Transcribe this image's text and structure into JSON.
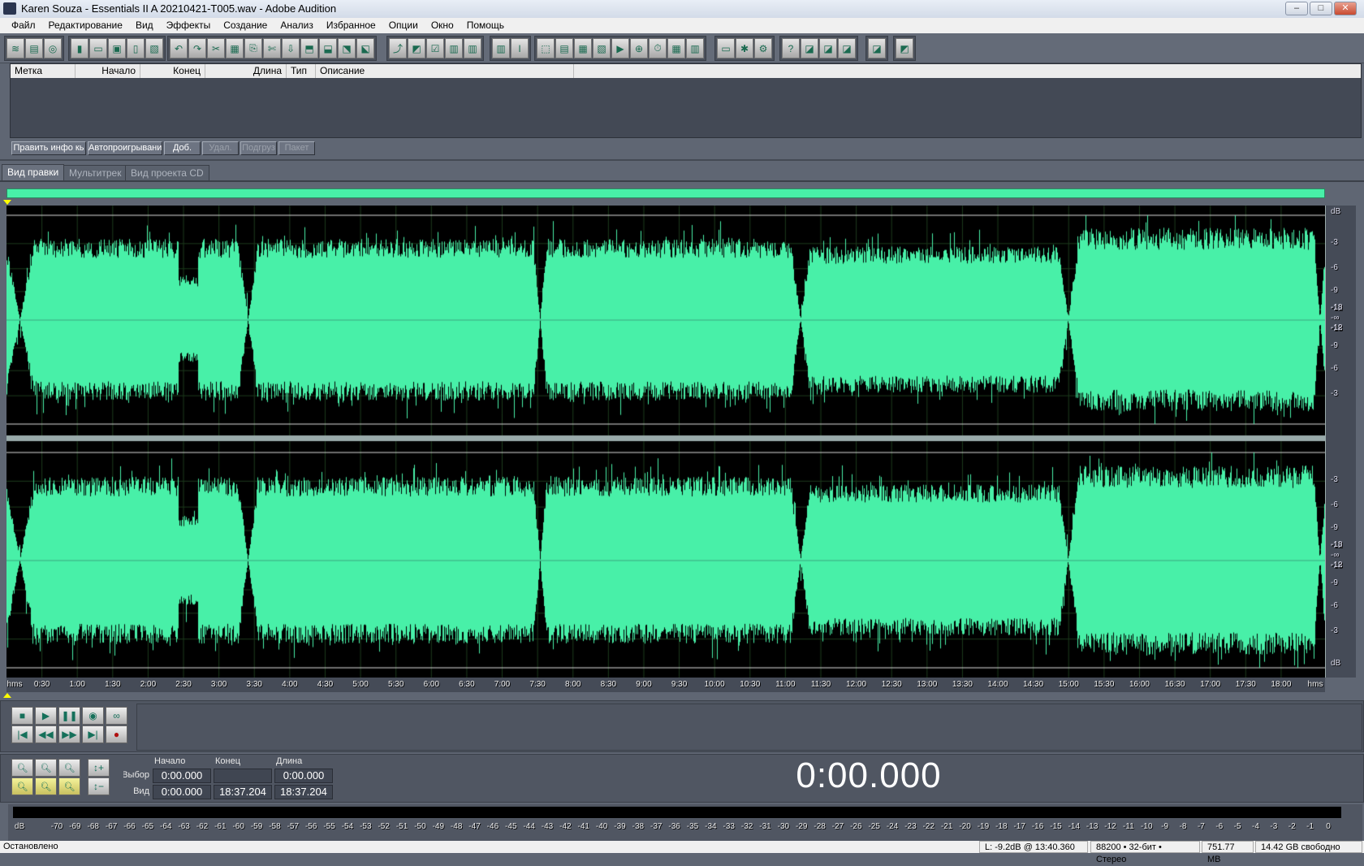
{
  "window": {
    "title": "Karen Souza - Essentials II  A 20210421-T005.wav - Adobe Audition",
    "controls": [
      "–",
      "□",
      "✕"
    ]
  },
  "menu": [
    "Файл",
    "Редактирование",
    "Вид",
    "Эффекты",
    "Создание",
    "Анализ",
    "Избранное",
    "Опции",
    "Окно",
    "Помощь"
  ],
  "markers": {
    "columns": [
      "Метка",
      "Начало",
      "Конец",
      "Длина",
      "Тип",
      "Описание"
    ],
    "buttons": [
      {
        "label": "Править инфо кь",
        "enabled": true
      },
      {
        "label": "Автопроигрывани",
        "enabled": true
      },
      {
        "label": "Доб.",
        "enabled": true
      },
      {
        "label": "Удал.",
        "enabled": false
      },
      {
        "label": "Подгруз",
        "enabled": false
      },
      {
        "label": "Пакет",
        "enabled": false
      }
    ]
  },
  "tabs": [
    {
      "label": "Вид правки",
      "active": true
    },
    {
      "label": "Мультитрек",
      "active": false
    },
    {
      "label": "Вид проекта CD",
      "active": false
    }
  ],
  "waveform": {
    "color": "#48f0a8",
    "channels": 2,
    "duration": "18:37.204"
  },
  "db_scale": {
    "unit": "dB",
    "labels": [
      "-3",
      "-6",
      "-9",
      "-12",
      "-18",
      "-∞",
      "-18",
      "-12",
      "-9",
      "-6",
      "-3"
    ]
  },
  "ruler": {
    "unit": "hms",
    "labels": [
      "0:30",
      "1:00",
      "1:30",
      "2:00",
      "2:30",
      "3:00",
      "3:30",
      "4:00",
      "4:30",
      "5:00",
      "5:30",
      "6:00",
      "6:30",
      "7:00",
      "7:30",
      "8:00",
      "8:30",
      "9:00",
      "9:30",
      "10:00",
      "10:30",
      "11:00",
      "11:30",
      "12:00",
      "12:30",
      "13:00",
      "13:30",
      "14:00",
      "14:30",
      "15:00",
      "15:30",
      "16:00",
      "16:30",
      "17:00",
      "17:30",
      "18:00"
    ]
  },
  "transport": {
    "buttons": [
      "stop",
      "play",
      "pause",
      "play-to-end",
      "loop",
      "go-to-start",
      "rewind",
      "fast-forward",
      "go-to-end",
      "record"
    ]
  },
  "selection": {
    "headers": [
      "Начало",
      "Конец",
      "Длина"
    ],
    "rows": [
      {
        "label": "Выбор",
        "start": "0:00.000",
        "end": "",
        "length": "0:00.000"
      },
      {
        "label": "Вид",
        "start": "0:00.000",
        "end": "18:37.204",
        "length": "18:37.204"
      }
    ]
  },
  "time_display": "0:00.000",
  "meter": {
    "unit": "dB",
    "labels": [
      "-70",
      "-69",
      "-68",
      "-67",
      "-66",
      "-65",
      "-64",
      "-63",
      "-62",
      "-61",
      "-60",
      "-59",
      "-58",
      "-57",
      "-56",
      "-55",
      "-54",
      "-53",
      "-52",
      "-51",
      "-50",
      "-49",
      "-48",
      "-47",
      "-46",
      "-45",
      "-44",
      "-43",
      "-42",
      "-41",
      "-40",
      "-39",
      "-38",
      "-37",
      "-36",
      "-35",
      "-34",
      "-33",
      "-32",
      "-31",
      "-30",
      "-29",
      "-28",
      "-27",
      "-26",
      "-25",
      "-24",
      "-23",
      "-22",
      "-21",
      "-20",
      "-19",
      "-18",
      "-17",
      "-16",
      "-15",
      "-14",
      "-13",
      "-12",
      "-11",
      "-10",
      "-9",
      "-8",
      "-7",
      "-6",
      "-5",
      "-4",
      "-3",
      "-2",
      "-1",
      "0"
    ]
  },
  "status": {
    "state": "Остановлено",
    "level": "L: -9.2dB @  13:40.360",
    "format": "88200 • 32-бит • Стерео",
    "size": "751.77 MB",
    "free": "14.42 GB свободно"
  }
}
